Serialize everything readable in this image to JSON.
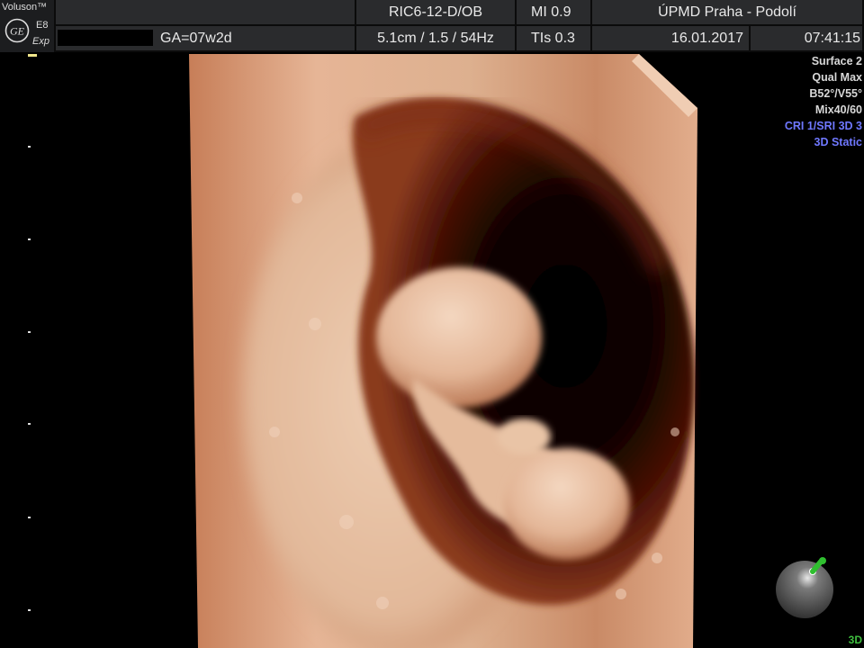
{
  "header": {
    "brand": "Voluson™",
    "model": "E8",
    "mode": "Exp",
    "gestational_age": "GA=07w2d",
    "probe": "RIC6-12-D/OB",
    "probe_params": "5.1cm / 1.5 / 54Hz",
    "mi": "MI  0.9",
    "tis": "TIs  0.3",
    "institution": "ÚPMD Praha - Podolí",
    "date": "16.01.2017",
    "time": "07:41:15"
  },
  "params": {
    "lines": [
      "Surface 2",
      "Qual Max",
      "B52°/V55°",
      "Mix40/60"
    ],
    "blue_lines": [
      "CRI 1/SRI 3D 3",
      "3D Static"
    ]
  },
  "indicator": {
    "mode_label": "3D"
  },
  "colors": {
    "header_bg": "#2a2b2d",
    "accent_blue": "#6f78ff",
    "mode_green": "#3fbf3f",
    "tissue": "#c98a63"
  },
  "icons": {
    "logo": "ge-logo-icon",
    "orientation": "orientation-ball-icon"
  }
}
